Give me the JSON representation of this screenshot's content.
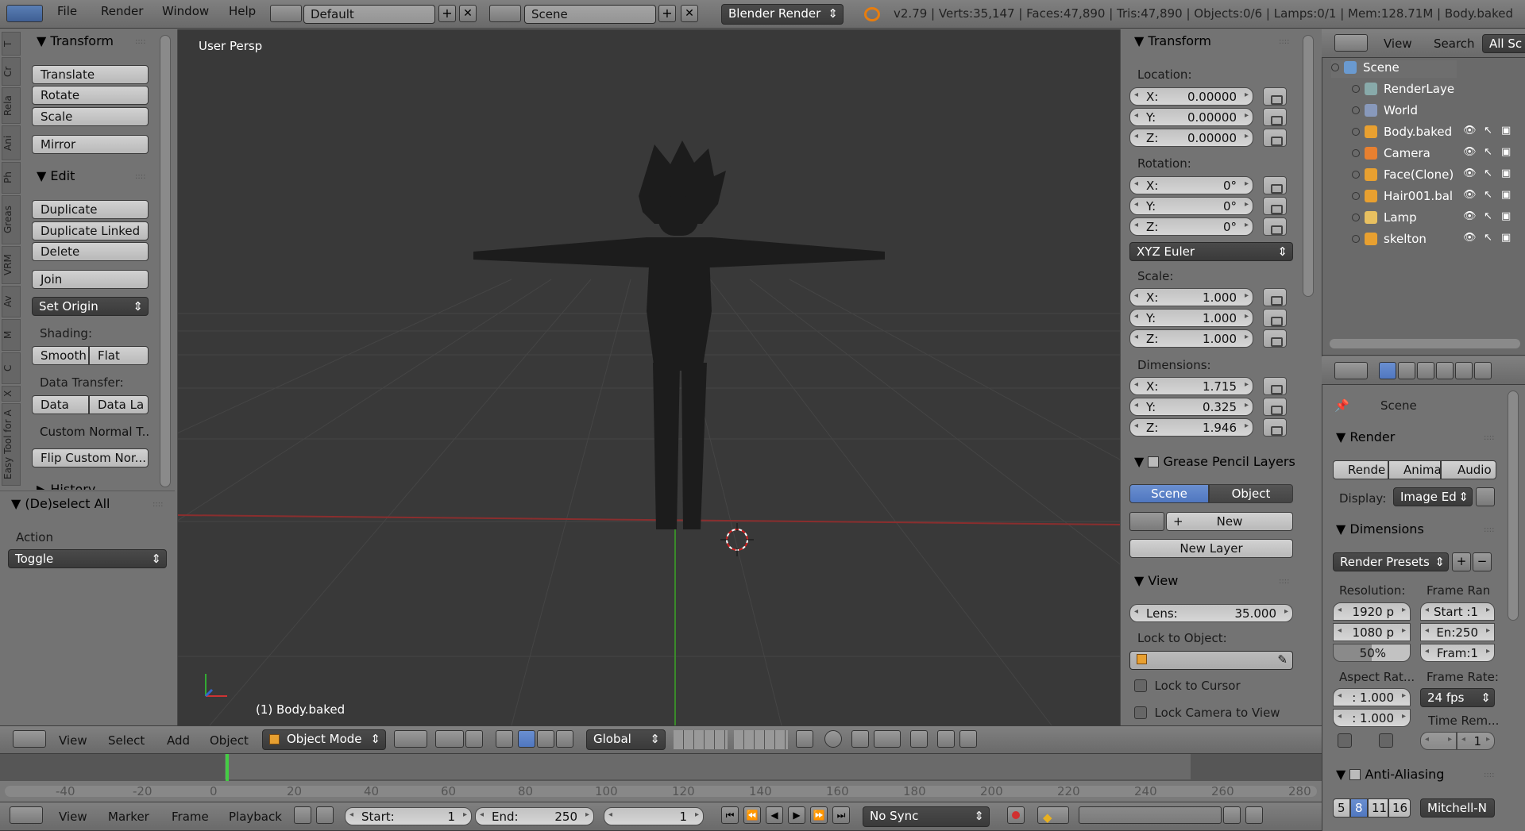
{
  "topbar": {
    "menus": [
      "File",
      "Render",
      "Window",
      "Help"
    ],
    "screen": "Default",
    "scene": "Scene",
    "engine": "Blender Render",
    "stats": "v2.79 | Verts:35,147 | Faces:47,890 | Tris:47,890 | Objects:0/6 | Lamps:0/1 | Mem:128.71M | Body.baked"
  },
  "toolshelf": {
    "tabs": [
      "T",
      "Cr",
      "Rela",
      "Ani",
      "Ph",
      "Greas",
      "VRM",
      "Av",
      "M",
      "C",
      "X",
      "Easy Tool for A"
    ],
    "transform_title": "Transform",
    "translate": "Translate",
    "rotate": "Rotate",
    "scale": "Scale",
    "mirror": "Mirror",
    "edit_title": "Edit",
    "duplicate": "Duplicate",
    "duplicate_linked": "Duplicate Linked",
    "delete": "Delete",
    "join": "Join",
    "set_origin": "Set Origin",
    "shading_label": "Shading:",
    "smooth": "Smooth",
    "flat": "Flat",
    "data_transfer_label": "Data Transfer:",
    "data": "Data",
    "data_la": "Data La",
    "custom_normal": "Custom Normal T...",
    "flip_custom": "Flip Custom Nor...",
    "history_title": "History"
  },
  "operator": {
    "title": "(De)select All",
    "action_label": "Action",
    "action_value": "Toggle"
  },
  "viewport": {
    "view_label": "User Persp",
    "object_label": "(1) Body.baked"
  },
  "nprops": {
    "transform_title": "Transform",
    "location_label": "Location:",
    "location": [
      {
        "k": "X:",
        "v": "0.00000"
      },
      {
        "k": "Y:",
        "v": "0.00000"
      },
      {
        "k": "Z:",
        "v": "0.00000"
      }
    ],
    "rotation_label": "Rotation:",
    "rotation": [
      {
        "k": "X:",
        "v": "0°"
      },
      {
        "k": "Y:",
        "v": "0°"
      },
      {
        "k": "Z:",
        "v": "0°"
      }
    ],
    "rotation_mode": "XYZ Euler",
    "scale_label": "Scale:",
    "scale": [
      {
        "k": "X:",
        "v": "1.000"
      },
      {
        "k": "Y:",
        "v": "1.000"
      },
      {
        "k": "Z:",
        "v": "1.000"
      }
    ],
    "dimensions_label": "Dimensions:",
    "dimensions": [
      {
        "k": "X:",
        "v": "1.715"
      },
      {
        "k": "Y:",
        "v": "0.325"
      },
      {
        "k": "Z:",
        "v": "1.946"
      }
    ],
    "gp_title": "Grease Pencil Layers",
    "gp_scene": "Scene",
    "gp_object": "Object",
    "gp_new": "New",
    "gp_new_layer": "New Layer",
    "view_title": "View",
    "lens_label": "Lens:",
    "lens_value": "35.000",
    "lock_object_label": "Lock to Object:",
    "lock_cursor": "Lock to Cursor",
    "lock_camera": "Lock Camera to View"
  },
  "outliner": {
    "view": "View",
    "search": "Search",
    "all_scenes": "All Sc",
    "items": [
      {
        "label": "Scene",
        "level": 0
      },
      {
        "label": "RenderLaye",
        "level": 1
      },
      {
        "label": "World",
        "level": 1
      },
      {
        "label": "Body.baked",
        "level": 1
      },
      {
        "label": "Camera",
        "level": 1
      },
      {
        "label": "Face(Clone)",
        "level": 1
      },
      {
        "label": "Hair001.bal",
        "level": 1
      },
      {
        "label": "Lamp",
        "level": 1
      },
      {
        "label": "skelton",
        "level": 1
      }
    ]
  },
  "properties": {
    "scene": "Scene",
    "render_title": "Render",
    "render_btn": "Rende",
    "anim_btn": "Anima",
    "audio_btn": "Audio",
    "display_label": "Display:",
    "display_value": "Image Ed",
    "dimensions_title": "Dimensions",
    "render_presets": "Render Presets",
    "resolution_label": "Resolution:",
    "frame_range_label": "Frame Ran",
    "res_x": "1920 p",
    "res_y": "1080 p",
    "res_pct": "50%",
    "start": "Start :1",
    "end": "En:250",
    "frame": "Fram:1",
    "aspect_label": "Aspect Rat...",
    "frame_rate_label": "Frame Rate:",
    "aspect_x": ": 1.000",
    "aspect_y": ": 1.000",
    "fps": "24 fps",
    "time_rem_label": "Time Rem...",
    "time_rem_value": "1",
    "aa_title": "Anti-Aliasing",
    "aa_5": "5",
    "aa_8": "8",
    "aa_11": "11",
    "aa_16": "16",
    "aa_filter": "Mitchell-N"
  },
  "view3d_header": {
    "view": "View",
    "select": "Select",
    "add": "Add",
    "object": "Object",
    "mode": "Object Mode",
    "orientation": "Global"
  },
  "timeline": {
    "ticks": [
      "-40",
      "-20",
      "0",
      "20",
      "40",
      "60",
      "80",
      "100",
      "120",
      "140",
      "160",
      "180",
      "200",
      "220",
      "240",
      "260",
      "280"
    ],
    "view": "View",
    "marker": "Marker",
    "frame": "Frame",
    "playback": "Playback",
    "start_label": "Start:",
    "start_value": "1",
    "end_label": "End:",
    "end_value": "250",
    "current": "1",
    "sync": "No Sync"
  }
}
